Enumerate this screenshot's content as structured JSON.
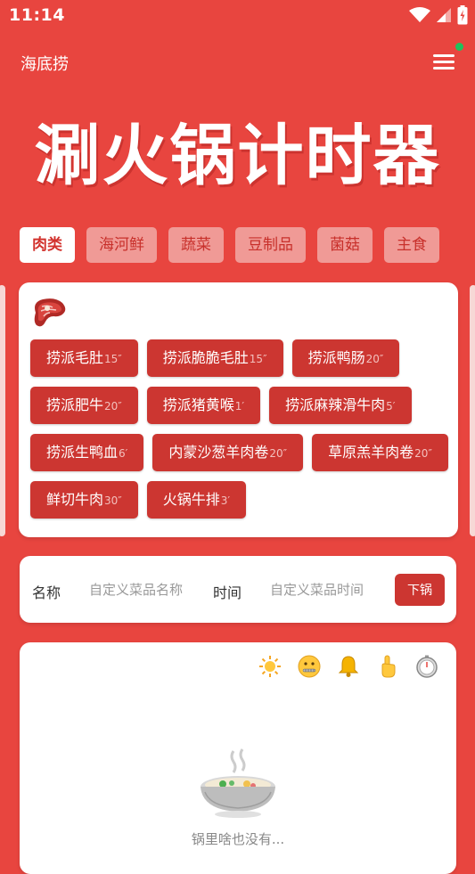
{
  "status": {
    "time": "11:14"
  },
  "app": {
    "title": "海底捞",
    "hero_title": "涮火锅计时器"
  },
  "categories": [
    {
      "label": "肉类",
      "active": true
    },
    {
      "label": "海河鲜",
      "active": false
    },
    {
      "label": "蔬菜",
      "active": false
    },
    {
      "label": "豆制品",
      "active": false
    },
    {
      "label": "菌菇",
      "active": false
    },
    {
      "label": "主食",
      "active": false
    }
  ],
  "menu": {
    "icon": "steak-icon",
    "dishes": [
      {
        "name": "捞派毛肚",
        "time": "15″"
      },
      {
        "name": "捞派脆脆毛肚",
        "time": "15″"
      },
      {
        "name": "捞派鸭肠",
        "time": "20″"
      },
      {
        "name": "捞派肥牛",
        "time": "20″"
      },
      {
        "name": "捞派猪黄喉",
        "time": "1′"
      },
      {
        "name": "捞派麻辣滑牛肉",
        "time": "5′"
      },
      {
        "name": "捞派生鸭血",
        "time": "6′"
      },
      {
        "name": "内蒙沙葱羊肉卷",
        "time": "20″"
      },
      {
        "name": "草原羔羊肉卷",
        "time": "20″"
      },
      {
        "name": "鲜切牛肉",
        "time": "30″"
      },
      {
        "name": "火锅牛排",
        "time": "3′"
      }
    ]
  },
  "custom": {
    "name_label": "名称",
    "name_placeholder": "自定义菜品名称",
    "time_label": "时间",
    "time_placeholder": "自定义菜品时间",
    "submit_label": "下锅"
  },
  "pot": {
    "tools": [
      "sun-icon",
      "zipper-mouth-icon",
      "bell-icon",
      "pointing-hand-icon",
      "stopwatch-icon"
    ],
    "empty_text": "锅里啥也没有..."
  },
  "colors": {
    "background": "#e8453f",
    "accent": "#cc3631",
    "card": "#ffffff"
  }
}
